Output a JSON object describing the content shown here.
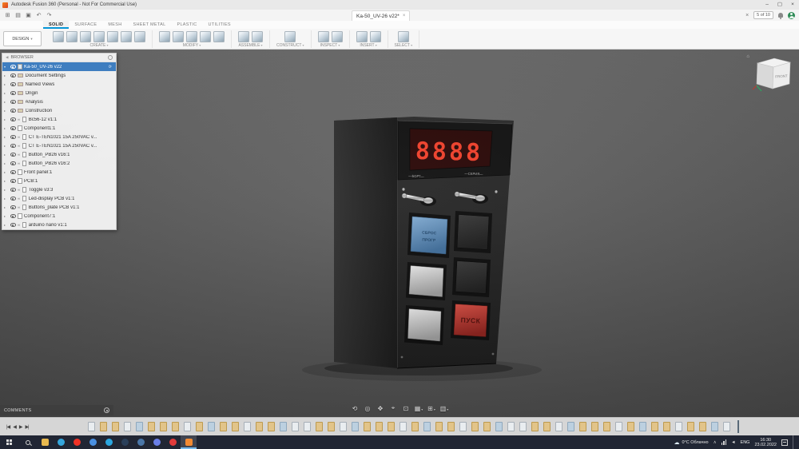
{
  "app": {
    "accent_color": "#0696d7",
    "selection_color": "#3f7ec0"
  },
  "titlebar": {
    "title": "Autodesk Fusion 360 (Personal - Not For Commercial Use)",
    "window_controls": {
      "minimize": "–",
      "maximize": "▢",
      "close": "×"
    }
  },
  "quickbar": {
    "left_icons": [
      {
        "name": "app-grid-icon",
        "glyph": "⊞"
      },
      {
        "name": "file-icon",
        "glyph": "▤"
      },
      {
        "name": "save-icon",
        "glyph": "▣"
      },
      {
        "name": "undo-icon",
        "glyph": "↶"
      },
      {
        "name": "redo-icon",
        "glyph": "↷"
      }
    ],
    "doc_tab": "Ka-50_UV-26 v22*",
    "doc_close": "×",
    "doc_counter": "5 of 10"
  },
  "ribbon": {
    "workspace_label": "DESIGN",
    "tabs": [
      {
        "label": "SOLID",
        "active": true
      },
      {
        "label": "SURFACE"
      },
      {
        "label": "MESH"
      },
      {
        "label": "SHEET METAL"
      },
      {
        "label": "PLASTIC"
      },
      {
        "label": "UTILITIES"
      }
    ],
    "groups": [
      {
        "label": "CREATE",
        "icons": 7
      },
      {
        "label": "MODIFY",
        "icons": 5
      },
      {
        "label": "ASSEMBLE",
        "icons": 2
      },
      {
        "label": "CONSTRUCT",
        "icons": 1
      },
      {
        "label": "INSPECT",
        "icons": 2
      },
      {
        "label": "INSERT",
        "icons": 2
      },
      {
        "label": "SELECT",
        "icons": 1
      }
    ]
  },
  "browser": {
    "header": "BROWSER",
    "collapse_glyph": "◀",
    "root_label": "Ka-50_UV-26 v22",
    "root_sync_glyph": "⟳",
    "items": [
      {
        "label": "Document Settings",
        "type": "folder"
      },
      {
        "label": "Named Views",
        "type": "folder"
      },
      {
        "label": "Origin",
        "type": "folder"
      },
      {
        "label": "Analysis",
        "type": "folder"
      },
      {
        "label": "Construction",
        "type": "folder"
      },
      {
        "label": "Bc56-12 v1:1",
        "type": "linked"
      },
      {
        "label": "Component1:1",
        "type": "component"
      },
      {
        "label": "CT E-TEN1021 15A 250VAC v...",
        "type": "linked"
      },
      {
        "label": "CT E-TEN1021 15A 250VAC v...",
        "type": "linked"
      },
      {
        "label": "Button_PB26 v16:1",
        "type": "linked"
      },
      {
        "label": "Button_PB26 v16:2",
        "type": "linked"
      },
      {
        "label": "Front panel:1",
        "type": "component"
      },
      {
        "label": "PCB:1",
        "type": "component"
      },
      {
        "label": "Toggle v3:3",
        "type": "linked"
      },
      {
        "label": "Led-display PCB v1:1",
        "type": "linked"
      },
      {
        "label": "Buttons_plate PCB v1:1",
        "type": "linked"
      },
      {
        "label": "Component7:1",
        "type": "component"
      },
      {
        "label": "arduino nano v1:1",
        "type": "linked"
      }
    ]
  },
  "viewport": {
    "viewcube_label": "FRONT",
    "home_glyph": "⌂",
    "comments_label": "COMMENTS",
    "navbar": [
      {
        "name": "orbit-icon",
        "glyph": "⟲"
      },
      {
        "name": "look-at-icon",
        "glyph": "◎"
      },
      {
        "name": "pan-icon",
        "glyph": "✥"
      },
      {
        "name": "zoom-icon",
        "glyph": "⌖"
      },
      {
        "name": "fit-icon",
        "glyph": "⊡"
      },
      {
        "name": "display-settings-icon",
        "glyph": "▦",
        "caret": true
      },
      {
        "name": "grid-settings-icon",
        "glyph": "⊞",
        "caret": true
      },
      {
        "name": "viewports-icon",
        "glyph": "▥",
        "caret": true
      }
    ],
    "model": {
      "display_digits": "8888",
      "caption_left": "—БОРТ—",
      "caption_right": "—СЕРИЯ—",
      "blue_button_line1": "СБРОС",
      "blue_button_line2": "ПРОГР",
      "red_button_label": "ПУСК",
      "colors": {
        "body": "#1a1a1a",
        "display_red": "#f5402a",
        "blue_button": "#5b89b4",
        "red_button": "#c23b32"
      }
    }
  },
  "timeline": {
    "controls": [
      "|◀",
      "◀",
      "▶",
      "▶|"
    ],
    "feature_count": 54
  },
  "taskbar": {
    "apps": [
      {
        "name": "file-explorer",
        "color": "#e8b94f",
        "shape": "square"
      },
      {
        "name": "edge-browser",
        "color": "#35a6dc",
        "shape": "circle"
      },
      {
        "name": "yandex-browser",
        "color": "#f03226",
        "shape": "circle"
      },
      {
        "name": "chrome-browser",
        "color": "#4a90e2",
        "shape": "circle"
      },
      {
        "name": "telegram",
        "color": "#2ba6e0",
        "shape": "circle"
      },
      {
        "name": "steam",
        "color": "#2a3f5a",
        "shape": "circle"
      },
      {
        "name": "vk",
        "color": "#4a76a8",
        "shape": "circle"
      },
      {
        "name": "discord",
        "color": "#6a7fe8",
        "shape": "circle"
      },
      {
        "name": "opera-browser",
        "color": "#e23b3b",
        "shape": "circle"
      },
      {
        "name": "fusion-360",
        "color": "#f28a33",
        "shape": "square",
        "active": true
      }
    ],
    "tray": {
      "weather": "0°C Облачно",
      "lang": "ENG",
      "time": "16:30",
      "date": "23.02.2022"
    }
  }
}
